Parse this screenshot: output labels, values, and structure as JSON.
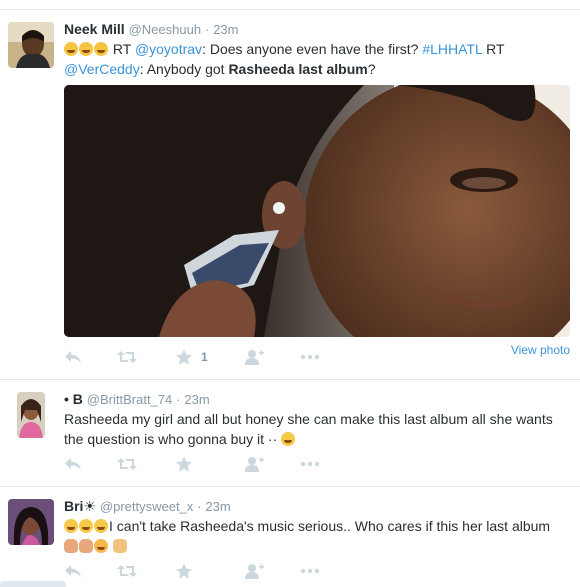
{
  "tweets": [
    {
      "fullname": "Neek Mill",
      "username": "@Neeshuuh",
      "time": "23m",
      "line1_rt": "RT",
      "line1_mention": "@yoyotrav",
      "line1_text": ": Does anyone even have the first?",
      "line1_hashtag": "#LHHATL",
      "line1_rt2": "RT",
      "line2_mention": "@VerCeddy",
      "line2_text": ": Anybody got",
      "line2_bold": "Rasheeda last album",
      "line2_end": "?",
      "favorite_count": "1",
      "view_photo": "View photo"
    },
    {
      "fullname": "• B ",
      "username": "@BrittBratt_74",
      "time": "23m",
      "text_line1": "Rasheeda my girl and all but honey she can make this last album all she wants",
      "text_line2": "the question is who gonna buy it ··"
    },
    {
      "fullname": "Bri☀",
      "username": "@prettysweet_x",
      "time": "23m",
      "text_line1": "I can't take Rasheeda's music serious.. Who cares if this her last album"
    }
  ],
  "separator": "·",
  "icons": {
    "reply": "reply-icon",
    "retweet": "retweet-icon",
    "favorite": "star-icon",
    "follow": "follow-icon",
    "more": "more-icon"
  },
  "colors": {
    "link": "#3b94d9",
    "secondary": "#8899a6",
    "action": "#ccd6dd",
    "border": "#e1e8ed"
  }
}
